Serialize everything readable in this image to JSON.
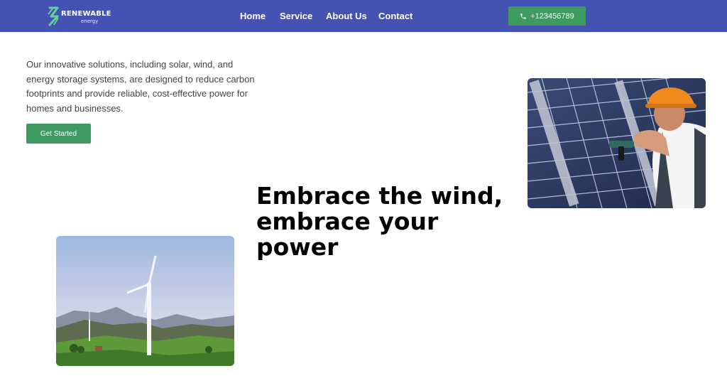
{
  "header": {
    "logo": {
      "word": "RENEWABLE",
      "sub": "energy"
    },
    "nav": [
      {
        "label": "Home"
      },
      {
        "label": "Service"
      },
      {
        "label": "About Us"
      },
      {
        "label": "Contact"
      }
    ],
    "phone": {
      "label": "+123456789",
      "icon": "phone-icon"
    }
  },
  "hero": {
    "intro": "Our innovative solutions, including solar, wind, and energy storage systems, are designed to reduce carbon footprints and provide reliable, cost-effective power for homes and businesses.",
    "cta_label": "Get Started",
    "headline": "Embrace the wind, embrace your power"
  },
  "colors": {
    "nav_bg": "#4452b4",
    "accent_green": "#3e9a61",
    "logo_green": "#63d19a"
  }
}
